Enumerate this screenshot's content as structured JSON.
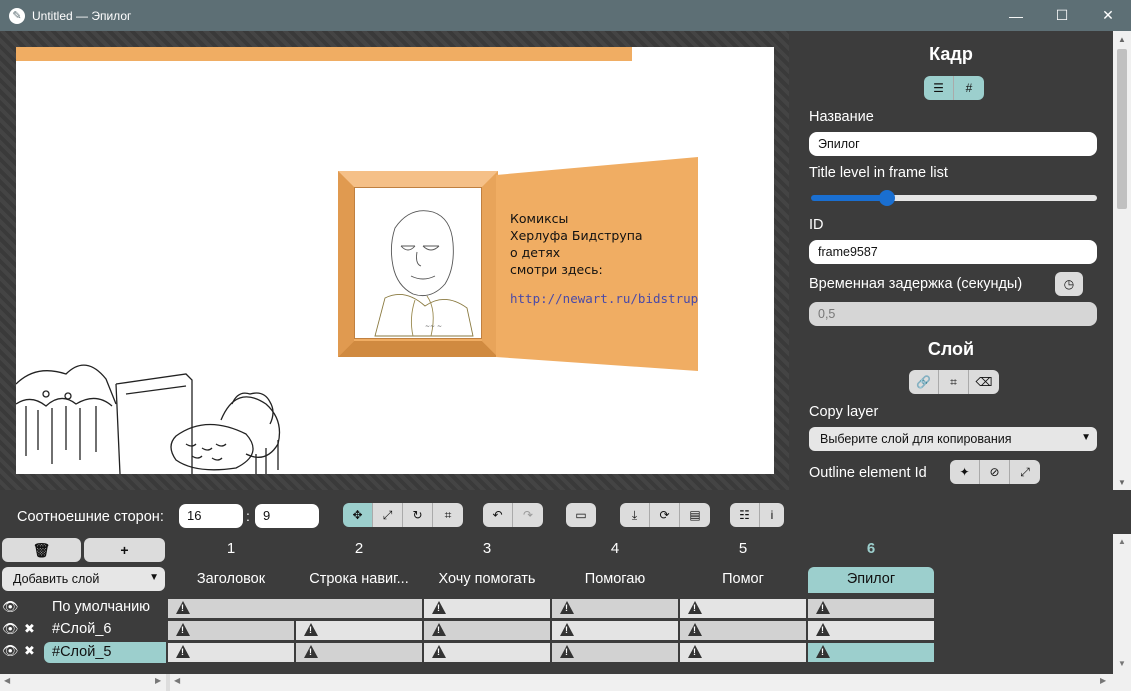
{
  "window": {
    "title": "Untitled — Эпилог",
    "minimize": "—",
    "maximize": "☐",
    "close": "✕"
  },
  "canvas": {
    "frame_text_lines": [
      "Комиксы",
      "Херлуфа Бидструпа",
      "о детях",
      "смотри здесь:"
    ],
    "link": "http://newart.ru/bidstrup"
  },
  "props": {
    "frame_title": "Кадр",
    "name_label": "Название",
    "name_value": "Эпилог",
    "title_level_label": "Title level in frame list",
    "title_level_value": 0.27,
    "id_label": "ID",
    "id_value": "frame9587",
    "delay_label": "Временная задержка (секунды)",
    "delay_value": "0,5",
    "layer_title": "Слой",
    "copy_layer_label": "Copy layer",
    "copy_layer_placeholder": "Выберите слой для копирования",
    "outline_label": "Outline element Id"
  },
  "toolbar": {
    "aspect_label": "Соотноешние сторон:",
    "aspect_w": "16",
    "aspect_h": "9",
    "colon": ":"
  },
  "timeline": {
    "delete_label": "🗑",
    "add_label": "+",
    "add_layer_placeholder": "Добавить слой",
    "columns": [
      {
        "num": "1",
        "name": "Заголовок"
      },
      {
        "num": "2",
        "name": "Строка навиг..."
      },
      {
        "num": "3",
        "name": "Хочу помогать"
      },
      {
        "num": "4",
        "name": "Помогаю"
      },
      {
        "num": "5",
        "name": "Помог"
      },
      {
        "num": "6",
        "name": "Эпилог"
      }
    ],
    "rows": [
      {
        "name": "По умолчанию"
      },
      {
        "name": "#Слой_6"
      },
      {
        "name": "#Слой_5"
      }
    ]
  },
  "colors": {
    "accent": "#9ccfcd",
    "orange": "#f0ad63",
    "titlebar": "#5d6f75"
  }
}
